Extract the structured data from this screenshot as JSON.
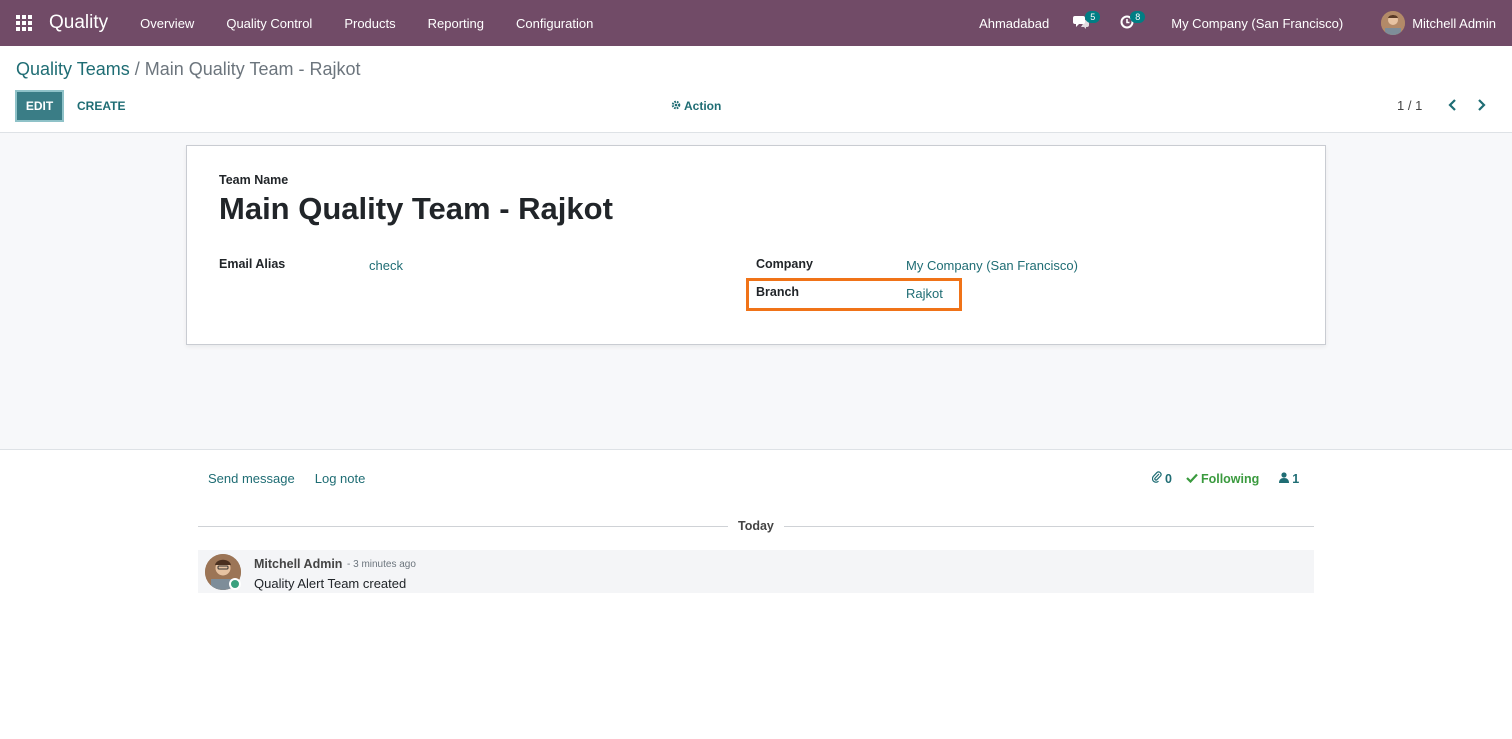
{
  "navbar": {
    "app_name": "Quality",
    "menu": [
      "Overview",
      "Quality Control",
      "Products",
      "Reporting",
      "Configuration"
    ],
    "branch": "Ahmadabad",
    "messages_count": "5",
    "activities_count": "8",
    "company": "My Company (San Francisco)",
    "user": "Mitchell Admin",
    "bg_color": "#714B67"
  },
  "breadcrumb": {
    "parent": "Quality Teams",
    "separator": "/",
    "current": "Main Quality Team - Rajkot"
  },
  "toolbar": {
    "edit_label": "EDIT",
    "create_label": "CREATE",
    "action_label": "Action",
    "pager": "1 / 1"
  },
  "form": {
    "team_name_label": "Team Name",
    "team_name": "Main Quality Team - Rajkot",
    "email_alias_label": "Email Alias",
    "email_alias": "check",
    "company_label": "Company",
    "company": "My Company (San Francisco)",
    "branch_label": "Branch",
    "branch": "Rajkot",
    "highlight_color": "#f07318"
  },
  "chatter": {
    "send_message": "Send message",
    "log_note": "Log note",
    "attachments_count": "0",
    "following_label": "Following",
    "followers_count": "1",
    "date_separator": "Today",
    "messages": [
      {
        "author": "Mitchell Admin",
        "date": "- 3 minutes ago",
        "body": "Quality Alert Team created"
      }
    ]
  },
  "icons": [
    "apps-grid-icon",
    "chat-bubbles-icon",
    "clock-icon",
    "gear-icon",
    "chevron-left-icon",
    "chevron-right-icon",
    "paperclip-icon",
    "check-icon",
    "user-icon"
  ]
}
